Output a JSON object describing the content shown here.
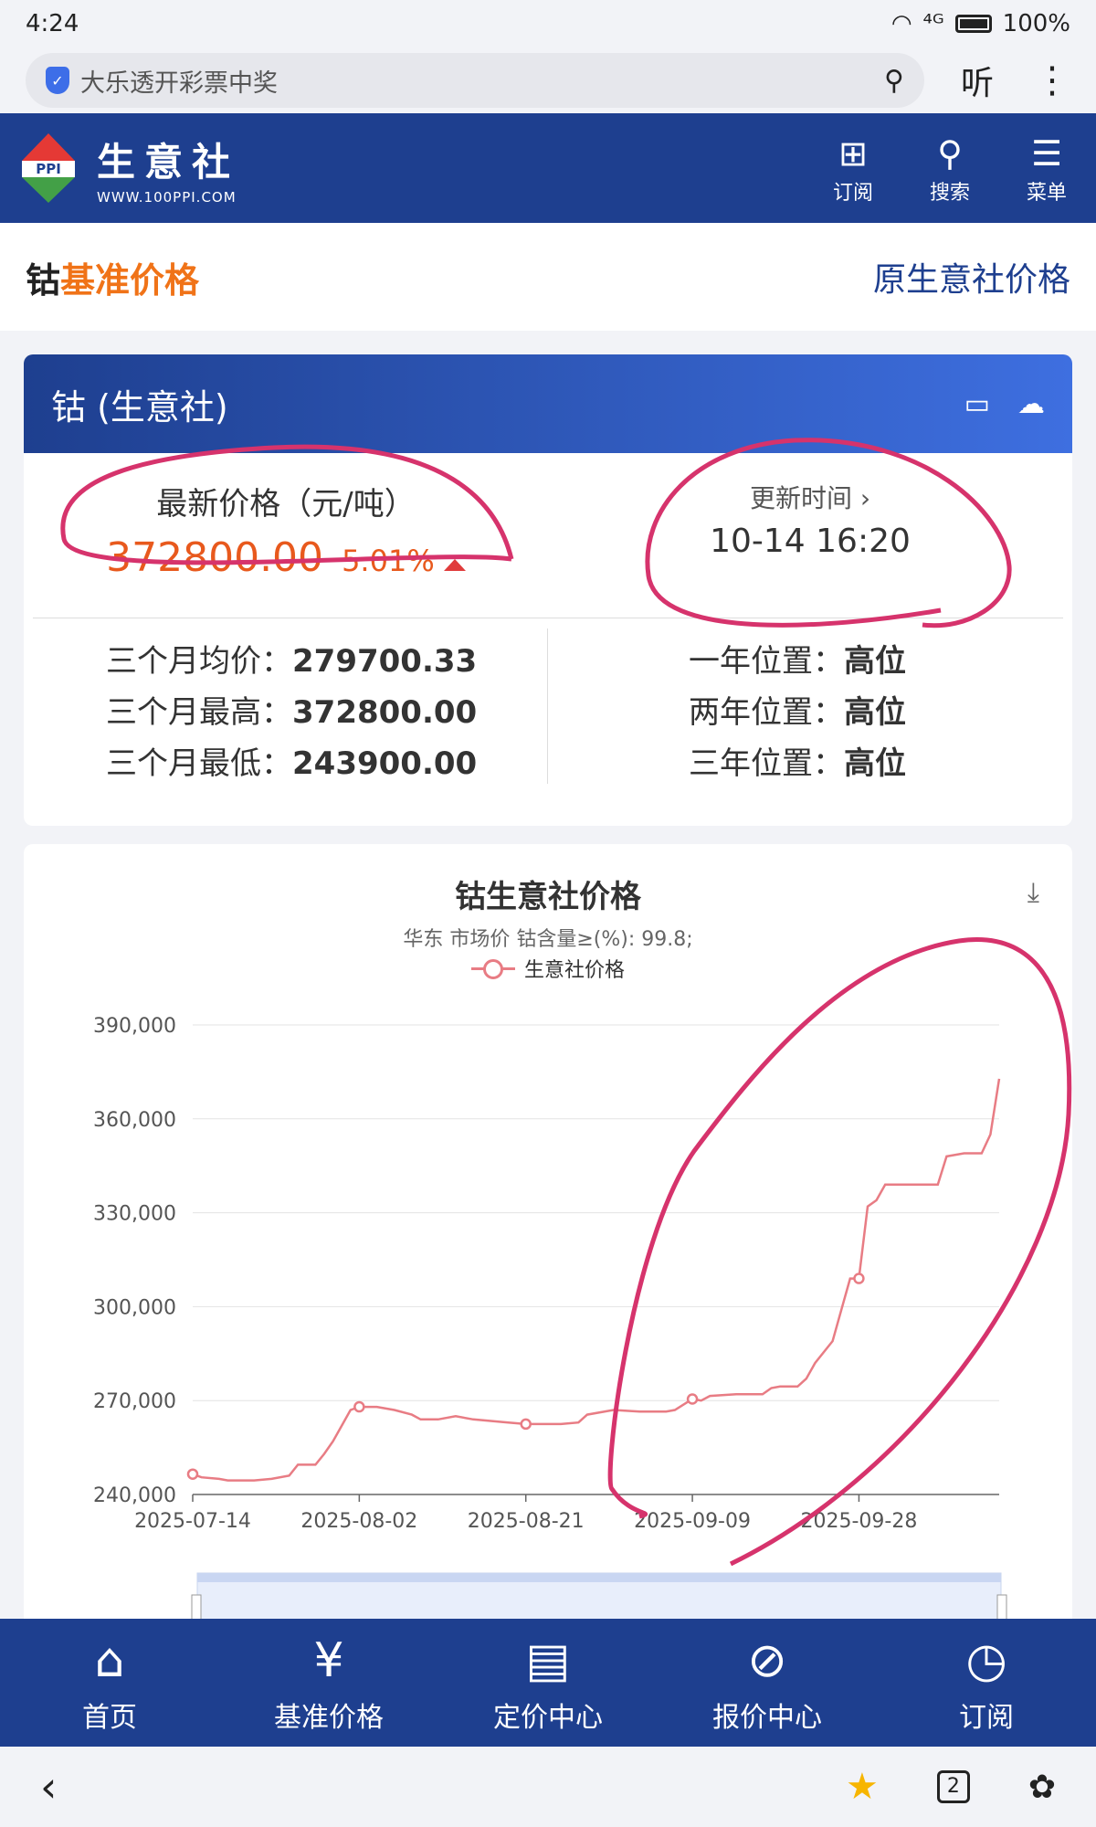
{
  "status": {
    "time": "4:24",
    "signal": "⁴ᴳ",
    "battery": "100%"
  },
  "browser": {
    "url_text": "大乐透开彩票中奖",
    "listen_label": "听"
  },
  "header": {
    "brand_name": "生意社",
    "brand_url": "WWW.100PPI.COM",
    "logo_text": "PPI",
    "actions": [
      {
        "icon": "bookmark-plus-icon",
        "label": "订阅"
      },
      {
        "icon": "search-icon",
        "label": "搜索"
      },
      {
        "icon": "menu-icon",
        "label": "菜单"
      }
    ]
  },
  "title_row": {
    "title_prefix": "钴",
    "title_highlight": "基准价格",
    "original_link": "原生意社价格"
  },
  "price_card": {
    "header_title": "钴 (生意社)",
    "latest_label": "最新价格（元/吨）",
    "latest_value": "372800.00",
    "change_pct": "5.01%",
    "update_label": "更新时间 ›",
    "update_time": "10-14 16:20",
    "stats_left": [
      {
        "label": "三个月均价：",
        "value": "279700.33"
      },
      {
        "label": "三个月最高：",
        "value": "372800.00"
      },
      {
        "label": "三个月最低：",
        "value": "243900.00"
      }
    ],
    "stats_right": [
      {
        "label": "一年位置：",
        "value": "高位"
      },
      {
        "label": "两年位置：",
        "value": "高位"
      },
      {
        "label": "三年位置：",
        "value": "高位"
      }
    ]
  },
  "chart_card": {
    "title": "钴生意社价格",
    "subtitle": "华东 市场价 钴含量≥(%): 99.8;",
    "legend": "生意社价格"
  },
  "chart_data": {
    "type": "line",
    "title": "钴生意社价格",
    "subtitle": "华东 市场价 钴含量≥(%): 99.8;",
    "series": [
      {
        "name": "生意社价格",
        "color": "#e87c84",
        "points": [
          [
            "2025-07-14",
            246500
          ],
          [
            "2025-07-15",
            245500
          ],
          [
            "2025-07-17",
            245000
          ],
          [
            "2025-07-18",
            244500
          ],
          [
            "2025-07-21",
            244500
          ],
          [
            "2025-07-23",
            245000
          ],
          [
            "2025-07-25",
            246000
          ],
          [
            "2025-07-26",
            249500
          ],
          [
            "2025-07-28",
            249500
          ],
          [
            "2025-07-29",
            253000
          ],
          [
            "2025-07-30",
            257000
          ],
          [
            "2025-07-31",
            262000
          ],
          [
            "2025-08-01",
            267000
          ],
          [
            "2025-08-02",
            268000
          ],
          [
            "2025-08-04",
            268000
          ],
          [
            "2025-08-06",
            267000
          ],
          [
            "2025-08-08",
            265500
          ],
          [
            "2025-08-09",
            264000
          ],
          [
            "2025-08-11",
            264000
          ],
          [
            "2025-08-13",
            265000
          ],
          [
            "2025-08-15",
            264000
          ],
          [
            "2025-08-17",
            263500
          ],
          [
            "2025-08-19",
            263000
          ],
          [
            "2025-08-21",
            262500
          ],
          [
            "2025-08-23",
            262500
          ],
          [
            "2025-08-25",
            262500
          ],
          [
            "2025-08-27",
            263000
          ],
          [
            "2025-08-28",
            265500
          ],
          [
            "2025-08-31",
            267000
          ],
          [
            "2025-09-03",
            266500
          ],
          [
            "2025-09-06",
            266500
          ],
          [
            "2025-09-07",
            267000
          ],
          [
            "2025-09-09",
            270500
          ],
          [
            "2025-09-10",
            270000
          ],
          [
            "2025-09-11",
            271500
          ],
          [
            "2025-09-14",
            272000
          ],
          [
            "2025-09-16",
            272000
          ],
          [
            "2025-09-17",
            272000
          ],
          [
            "2025-09-18",
            274000
          ],
          [
            "2025-09-19",
            274500
          ],
          [
            "2025-09-21",
            274500
          ],
          [
            "2025-09-22",
            277000
          ],
          [
            "2025-09-23",
            282000
          ],
          [
            "2025-09-25",
            289000
          ],
          [
            "2025-09-26",
            299000
          ],
          [
            "2025-09-27",
            309000
          ],
          [
            "2025-09-28",
            309000
          ],
          [
            "2025-09-29",
            332000
          ],
          [
            "2025-09-30",
            334000
          ],
          [
            "2025-10-01",
            339000
          ],
          [
            "2025-10-07",
            339000
          ],
          [
            "2025-10-08",
            348000
          ],
          [
            "2025-10-10",
            349000
          ],
          [
            "2025-10-12",
            349000
          ],
          [
            "2025-10-13",
            355000
          ],
          [
            "2025-10-14",
            372800
          ]
        ],
        "markers": [
          "2025-07-14",
          "2025-08-02",
          "2025-08-21",
          "2025-09-09",
          "2025-09-28"
        ]
      }
    ],
    "x_ticks": [
      "2025-07-14",
      "2025-08-02",
      "2025-08-21",
      "2025-09-09",
      "2025-09-28"
    ],
    "y_ticks": [
      240000,
      270000,
      300000,
      330000,
      360000,
      390000
    ],
    "y_tick_labels": [
      "240,000",
      "270,000",
      "300,000",
      "330,000",
      "360,000",
      "390,000"
    ],
    "ylim": [
      240000,
      390000
    ],
    "xlim": [
      "2025-07-14",
      "2025-10-14"
    ],
    "grid": true,
    "legend_position": "top-center"
  },
  "bottom_nav": [
    {
      "icon": "home-icon",
      "label": "首页"
    },
    {
      "icon": "yen-icon",
      "label": "基准价格"
    },
    {
      "icon": "document-icon",
      "label": "定价中心"
    },
    {
      "icon": "slash-circle-icon",
      "label": "报价中心"
    },
    {
      "icon": "clock-icon",
      "label": "订阅"
    }
  ],
  "system_bar": {
    "tabs_count": "2"
  },
  "colors": {
    "header_blue": "#1e3f8f",
    "accent_orange": "#f07318",
    "price_red": "#e8591d",
    "series_pink": "#e87c84",
    "annotation_magenta": "#d6336c"
  }
}
